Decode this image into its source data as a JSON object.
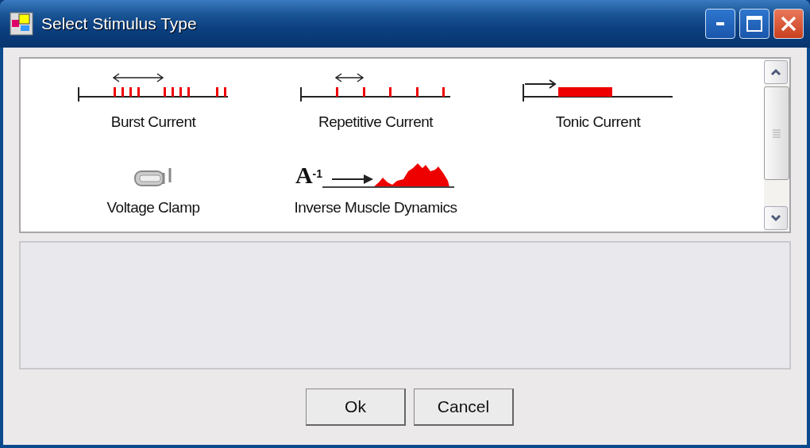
{
  "window": {
    "title": "Select Stimulus Type"
  },
  "stimulus_types": [
    {
      "kind": "burst",
      "label": "Burst Current"
    },
    {
      "kind": "repetitive",
      "label": "Repetitive Current"
    },
    {
      "kind": "tonic",
      "label": "Tonic Current"
    },
    {
      "kind": "clamp",
      "label": "Voltage Clamp"
    },
    {
      "kind": "inverse",
      "symbol": "A$^{-1}$",
      "label": "Inverse Muscle Dynamics"
    }
  ],
  "buttons": [
    {
      "label": "Ok"
    },
    {
      "label": "Cancel"
    }
  ]
}
